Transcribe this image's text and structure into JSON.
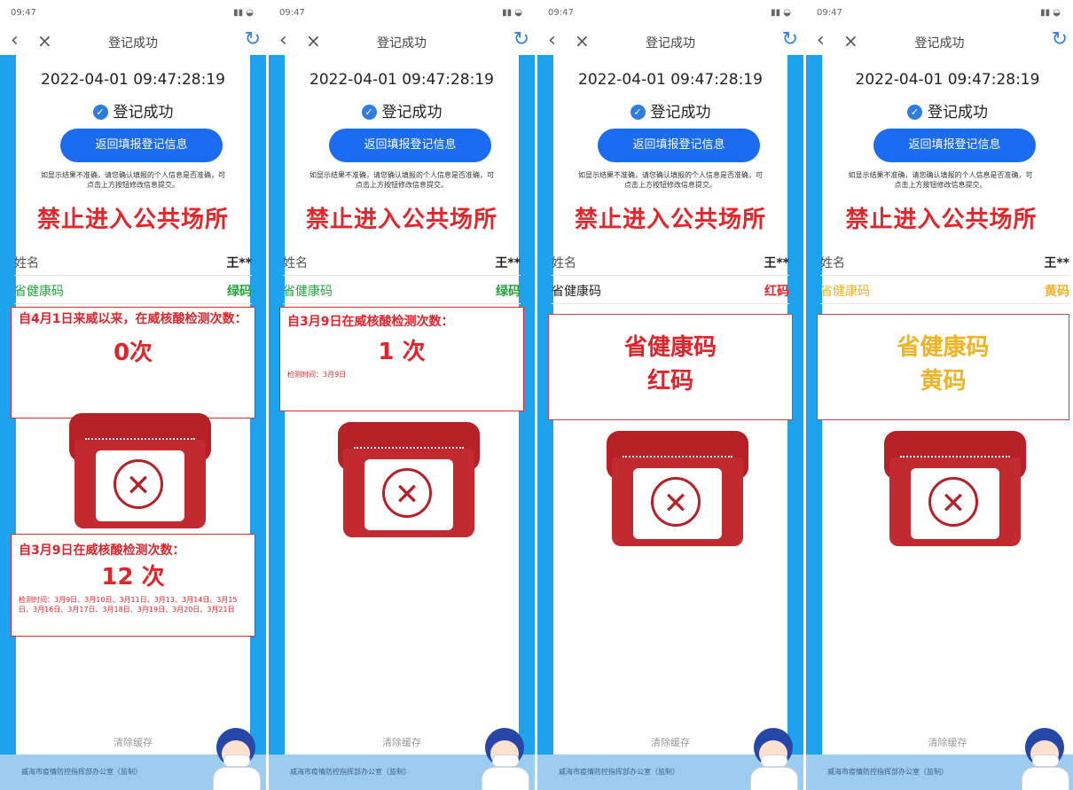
{
  "status": {
    "time": "09:47",
    "right": "4G"
  },
  "nav": {
    "title": "登记成功"
  },
  "datetime": "2022-04-01 09:47:28:19",
  "success_label": "登记成功",
  "return_button": "返回填报登记信息",
  "note_line1": "如显示结果不准确，请您确认填报的个人信息是否准确，可",
  "note_line2": "点击上方按钮修改信息提交。",
  "banner": "禁止进入公共场所",
  "name_label": "姓名",
  "name_value": "王**",
  "code_label": "省健康码",
  "footer_clear": "清除缓存",
  "footer_text": "威海市疫情防控指挥部办公室（监制）",
  "colors": {
    "red": "#e3262b",
    "green": "#22a63a",
    "yellow": "#f0b323",
    "blue": "#1ea2ee"
  },
  "panels": [
    {
      "code_value": "绿码",
      "box1_header": "自4月1日来威以来，在威核酸检测次数：",
      "box1_count": "0次",
      "box2_header": "自3月9日在威核酸检测次数：",
      "box2_count": "12 次",
      "box2_detail": "检测时间：3月9日、3月10日、3月11日、3月13、3月14日、3月15日、3月16日、3月17日、3月18日、3月19日、3月20日、3月21日"
    },
    {
      "code_value": "绿码",
      "box1_header": "自3月9日在威核酸检测次数：",
      "box1_count": "1 次",
      "box1_detail": "检测时间：3月9日"
    },
    {
      "code_value": "红码",
      "code_title": "省健康码",
      "code_status": "红码"
    },
    {
      "code_value": "黄码",
      "code_title": "省健康码",
      "code_status": "黄码"
    }
  ]
}
